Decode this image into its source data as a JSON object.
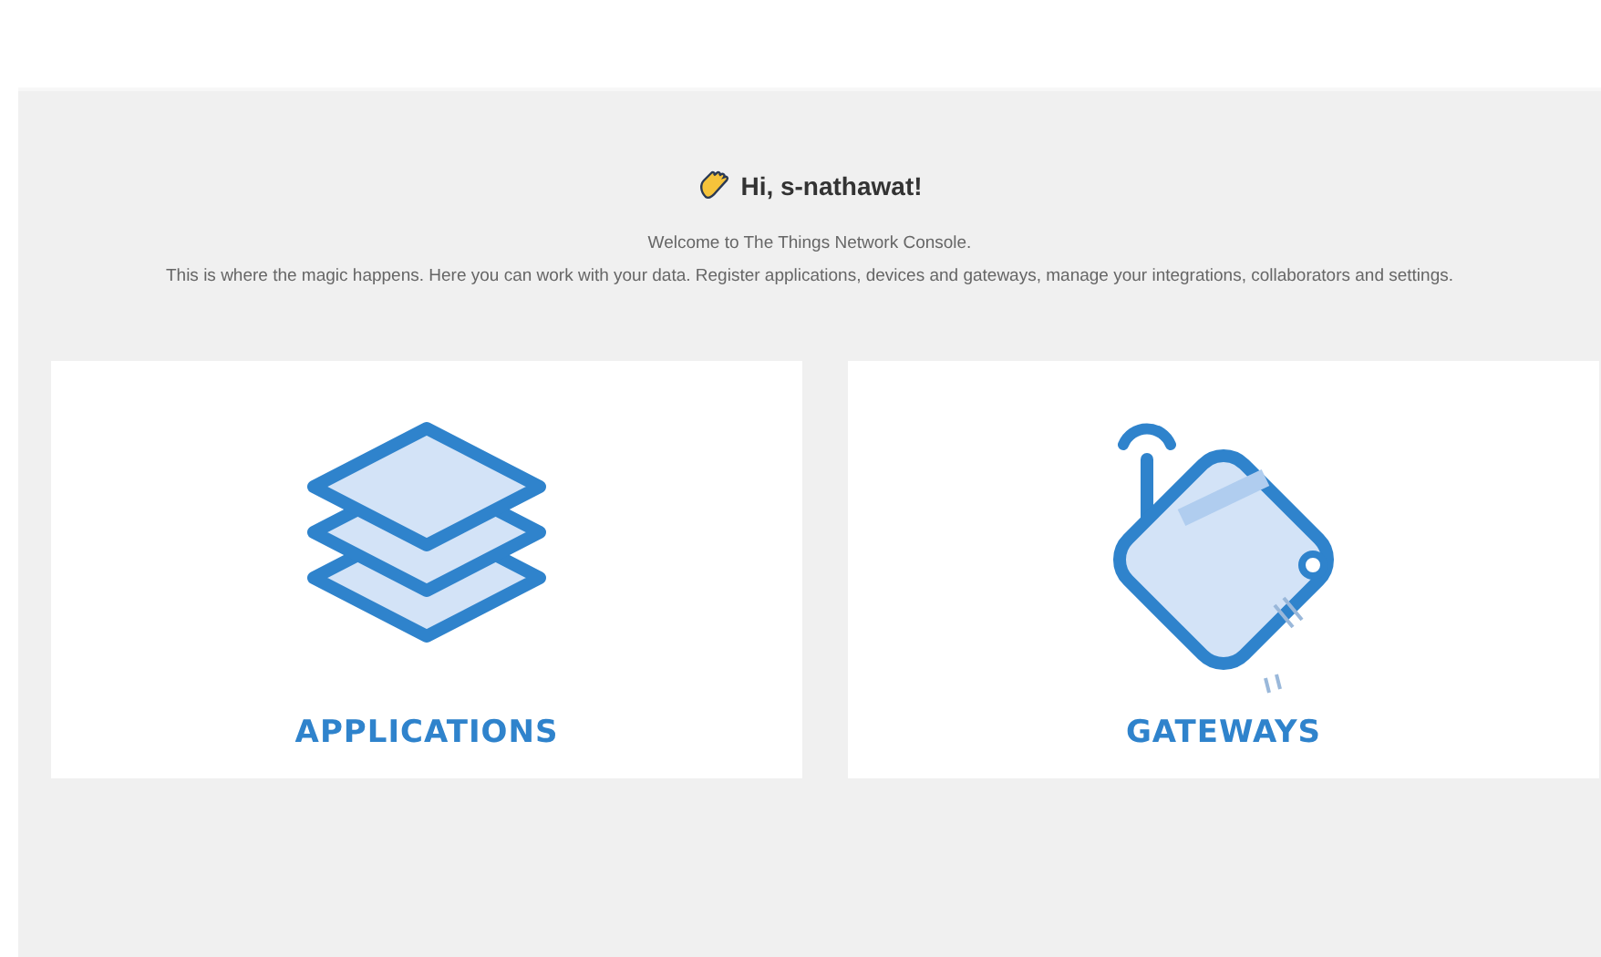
{
  "greeting": "Hi, s-nathawat!",
  "welcome": "Welcome to The Things Network Console.",
  "intro": "This is where the magic happens. Here you can work with your data. Register applications, devices and gateways, manage your integrations, collaborators and settings.",
  "cards": [
    {
      "kind": "applications",
      "label": "APPLICATIONS"
    },
    {
      "kind": "gateways",
      "label": "GATEWAYS"
    }
  ]
}
